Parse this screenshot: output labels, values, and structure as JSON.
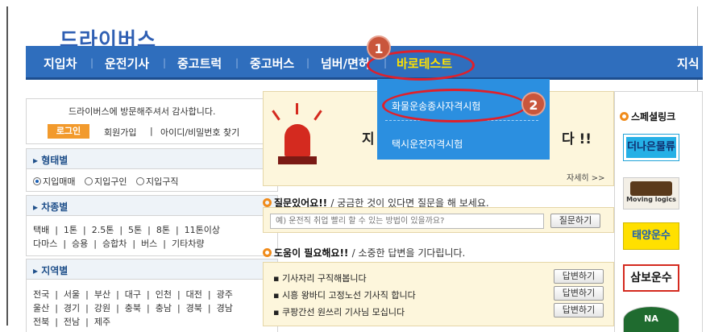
{
  "logo": "드라이버스",
  "nav": {
    "items": [
      "지입차",
      "운전기사",
      "중고트럭",
      "중고버스",
      "넘버/면허",
      "바로테스트"
    ],
    "active_index": 5,
    "right_cut": "지식"
  },
  "dropdown": {
    "items": [
      "화물운송종사자격시험",
      "택시운전자격시험"
    ]
  },
  "annotations": {
    "badge1": "1",
    "badge2": "2"
  },
  "login_panel": {
    "welcome": "드라이버스에 방문해주셔서 감사합니다.",
    "login_button": "로그인",
    "signup": "회원가입",
    "sep": "|",
    "find": "아이디/비밀번호 찾기"
  },
  "type_section": {
    "title": "형태별",
    "options": [
      "지입매매",
      "지입구인",
      "지입구직"
    ],
    "selected_index": 0
  },
  "vehicle_section": {
    "title": "차종별",
    "row1": "택배  |  1톤  |  2.5톤  |  5톤  |  8톤  |  11톤이상",
    "row2": "다마스  |  승용  |  승합차  |  버스  |  기타차량"
  },
  "region_section": {
    "title": "지역별",
    "row1": "전국  |  서울  |  부산  |  대구  |  인천  |  대전  |  광주",
    "row2": "울산  |  경기  |  강원  |  충북  |  충남  |  경북  |  경남",
    "row3": "전북  |  전남  |  제주"
  },
  "banner": {
    "title_left": "지",
    "title_right": "다 !!",
    "more": "자세히 >>"
  },
  "question": {
    "title": "질문있어요!!",
    "desc": "/ 궁금한 것이 있다면 질문을 해 보세요.",
    "placeholder": "예) 운전직 취업 빨리 할 수 있는 방법이 있을까요?",
    "button": "질문하기"
  },
  "help": {
    "title": "도움이 필요해요!!",
    "desc": "/ 소중한 답변을 기다립니다.",
    "items": [
      {
        "text": "기사자리 구직해봅니다",
        "button": "답변하기"
      },
      {
        "text": "시흥 왕바디 고정노선 기사직 합니다",
        "button": "답변하기"
      },
      {
        "text": "쿠팡간선 원쓰리 기사님 모십니다",
        "button": "답변하기"
      }
    ]
  },
  "special": {
    "title": "스페셜링크",
    "ads": [
      "더나은물류",
      "Moving logics",
      "태양운수",
      "삼보운수",
      "NA"
    ]
  },
  "colors": {
    "nav": "#2f6ebd",
    "dropdown": "#2b8fe0",
    "accent": "#f29a2c",
    "highlight_ring": "#e0202a",
    "active_nav": "#ffe200"
  }
}
